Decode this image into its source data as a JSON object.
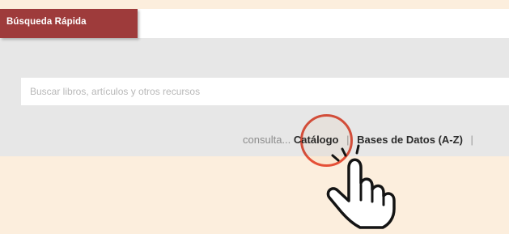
{
  "quick_search": {
    "tab_label": "Búsqueda Rápida",
    "search_placeholder": "Buscar libros, artículos y otros recursos",
    "links_prefix": "consulta...",
    "links": [
      "Catálogo",
      "Bases de Datos (A-Z)"
    ],
    "separator": "|"
  },
  "annotation": {
    "highlight_color": "#e8553f",
    "pointer_icon": "hand-pointer-icon"
  },
  "colors": {
    "background": "#fceedd",
    "tab_active": "#9e3b3b",
    "panel": "#e7e7e7"
  }
}
